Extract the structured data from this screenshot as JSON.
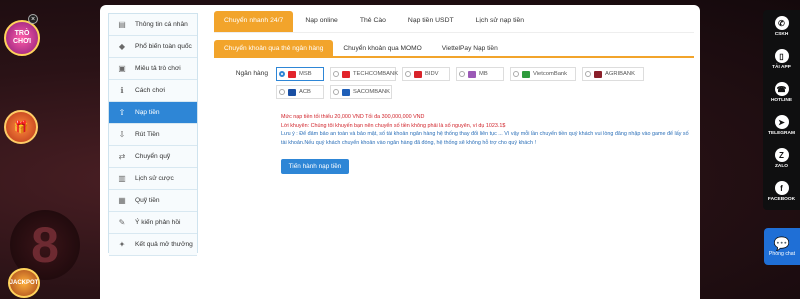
{
  "promos": {
    "badge1_text": "TRÒ CHƠI",
    "close": "×",
    "badge3_text": "JACKPOT",
    "decor_number": "8"
  },
  "sidebar": {
    "items": [
      {
        "label": "Thông tin cá nhân",
        "icon": "user-card-icon",
        "glyph": "▤"
      },
      {
        "label": "Phổ biến toàn quốc",
        "icon": "diamond-icon",
        "glyph": "◆"
      },
      {
        "label": "Miêu tả trò chơi",
        "icon": "image-icon",
        "glyph": "▣"
      },
      {
        "label": "Cách chơi",
        "icon": "info-icon",
        "glyph": "ℹ"
      },
      {
        "label": "Nạp tiền",
        "icon": "deposit-icon",
        "glyph": "⇧"
      },
      {
        "label": "Rút Tiền",
        "icon": "withdraw-icon",
        "glyph": "⇩"
      },
      {
        "label": "Chuyển quỹ",
        "icon": "transfer-icon",
        "glyph": "⇄"
      },
      {
        "label": "Lịch sử cược",
        "icon": "history-icon",
        "glyph": "▥"
      },
      {
        "label": "Quỹ tiền",
        "icon": "wallet-icon",
        "glyph": "▦"
      },
      {
        "label": "Ý kiến phản hồi",
        "icon": "feedback-icon",
        "glyph": "✎"
      },
      {
        "label": "Kết quả mở thưởng",
        "icon": "result-icon",
        "glyph": "✦"
      }
    ],
    "active_index": 4
  },
  "tabs_primary": [
    {
      "label": "Chuyển nhanh 24/7"
    },
    {
      "label": "Nạp online"
    },
    {
      "label": "Thẻ Cào"
    },
    {
      "label": "Nạp tiền USDT"
    },
    {
      "label": "Lịch sử nạp tiền"
    }
  ],
  "tabs_secondary": [
    {
      "label": "Chuyển khoản qua thẻ ngân hàng"
    },
    {
      "label": "Chuyển khoản qua MOMO"
    },
    {
      "label": "ViettelPay Nạp tiền"
    }
  ],
  "bank_section": {
    "label": "Ngân hàng",
    "banks": [
      {
        "name": "MSB",
        "color": "#e2242b",
        "selected": true
      },
      {
        "name": "TECHCOMBANK",
        "color": "#e2242b",
        "selected": false
      },
      {
        "name": "BIDV",
        "color": "#d8232a",
        "selected": false
      },
      {
        "name": "MB",
        "color": "#9b59b6",
        "selected": false
      },
      {
        "name": "VietcomBank",
        "color": "#2e9b3c",
        "selected": false
      },
      {
        "name": "AGRIBANK",
        "color": "#8a1f2a",
        "selected": false
      },
      {
        "name": "ACB",
        "color": "#1a4fa3",
        "selected": false
      },
      {
        "name": "SACOMBANK",
        "color": "#1f5fb8",
        "selected": false
      }
    ]
  },
  "notes": {
    "line1": "Mức nạp tiền tối thiểu 20,000 VND Tối đa 300,000,000 VND",
    "line2": "Lời khuyên: Chúng tôi khuyến bạn nên chuyển số tiền không phải là số nguyên, ví dụ 1023.1$",
    "line3": "Lưu ý : Để đảm bảo an toàn và bảo mật, số tài khoản ngân hàng hệ thống thay đổi liên tục ... Vì vậy mỗi lần chuyển tiền quý khách vui lòng đăng nhập vào game để lấy số tài khoản.Nếu quý khách chuyển khoản vào ngân hàng đã đóng, hệ thống sẽ không hỗ trợ cho quý khách !"
  },
  "submit_label": "Tiến hành nạp tiền",
  "right_bar": [
    {
      "label": "CSKH",
      "icon": "support-icon",
      "glyph": "✆"
    },
    {
      "label": "TẢI APP",
      "icon": "download-app-icon",
      "glyph": "▯"
    },
    {
      "label": "HOTLINE",
      "icon": "phone-icon",
      "glyph": "☎"
    },
    {
      "label": "TELEGRAM",
      "icon": "telegram-icon",
      "glyph": "➤"
    },
    {
      "label": "ZALO",
      "icon": "zalo-icon",
      "glyph": "Z"
    },
    {
      "label": "FACEBOOK",
      "icon": "facebook-icon",
      "glyph": "f"
    }
  ],
  "chat": {
    "label": "Phòng chat",
    "icon": "chat-bubbles-icon",
    "glyph": "💬"
  },
  "colors": {
    "accent": "#f2a42b",
    "primary": "#2e86d6",
    "alert": "#d1252c"
  }
}
